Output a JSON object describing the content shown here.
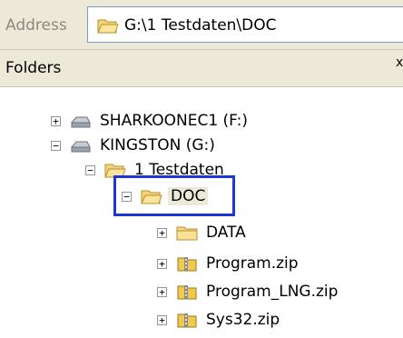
{
  "address_bar": {
    "label": "Address",
    "path": "G:\\1 Testdaten\\DOC"
  },
  "folders_pane": {
    "title": "Folders",
    "close_glyph": "x"
  },
  "tree": [
    {
      "label": "SHARKOONEC1 (F:)",
      "icon": "drive-icon",
      "expander": "+"
    },
    {
      "label": "KINGSTON (G:)",
      "icon": "drive-icon",
      "expander": "−"
    },
    {
      "label": "1 Testdaten",
      "icon": "folder-open-icon",
      "expander": "−"
    },
    {
      "label": "DOC",
      "icon": "folder-open-icon",
      "expander": "−",
      "selected": true
    },
    {
      "label": "DATA",
      "icon": "folder-icon",
      "expander": "+"
    },
    {
      "label": "Program.zip",
      "icon": "zip-folder-icon",
      "expander": "+"
    },
    {
      "label": "Program_LNG.zip",
      "icon": "zip-folder-icon",
      "expander": "+"
    },
    {
      "label": "Sys32.zip",
      "icon": "zip-folder-icon",
      "expander": "+"
    }
  ],
  "colors": {
    "highlight": "#1f35d6",
    "chrome": "#ece9d8"
  }
}
